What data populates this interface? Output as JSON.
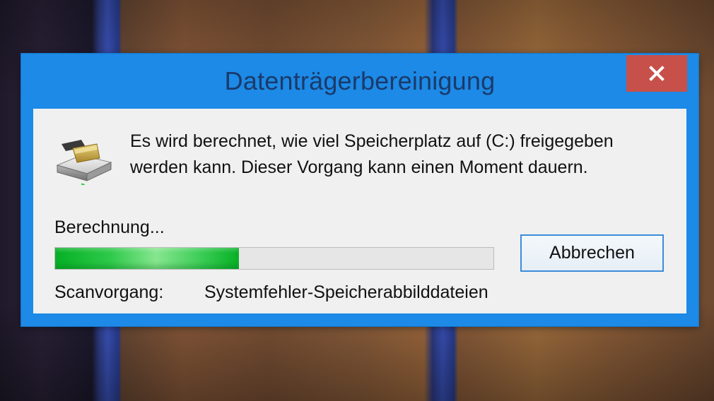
{
  "window": {
    "title": "Datenträgerbereinigung",
    "close_icon": "close-icon"
  },
  "message": {
    "line1": "Es wird berechnet, wie viel Speicherplatz auf  (C:) freigegeben",
    "line2": "werden kann. Dieser Vorgang kann einen Moment dauern."
  },
  "status": {
    "calculating_label": "Berechnung...",
    "progress_fraction": 0.42,
    "scan_label": "Scanvorgang:",
    "scan_value": "Systemfehler-Speicherabbilddateien"
  },
  "buttons": {
    "cancel_label": "Abbrechen"
  },
  "colors": {
    "title_bar": "#1c8ae6",
    "close_button": "#c7504a",
    "progress_fill": "#06b025",
    "client_background": "#f0f0f0"
  },
  "icons": {
    "disk_cleanup": "disk-cleanup-icon"
  }
}
